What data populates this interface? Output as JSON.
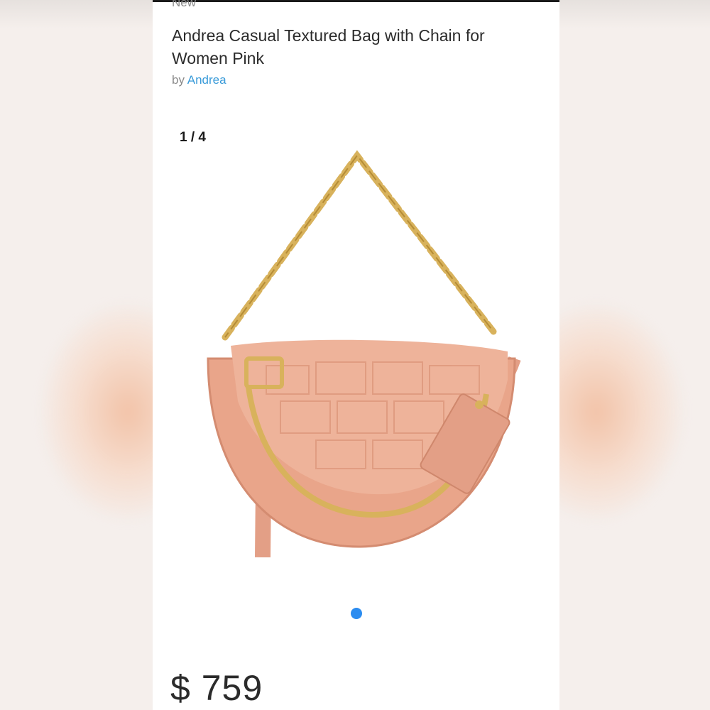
{
  "listing": {
    "condition": "New",
    "title": "Andrea Casual Textured Bag with Chain for Women Pink",
    "by_label": "by",
    "brand": "Andrea",
    "image_pager": "1 / 4",
    "price": "$ 759"
  },
  "carousel": {
    "active_dot_color": "#2b8cf0"
  },
  "colors": {
    "brand_link": "#3a9bd9",
    "bag_pink": "#e9a58a",
    "chain_gold": "#d8b25c"
  }
}
